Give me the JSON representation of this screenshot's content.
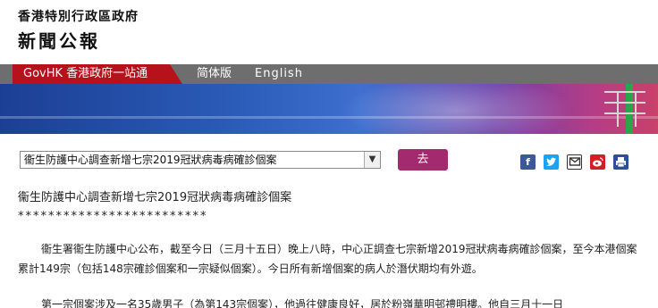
{
  "header": {
    "gov_name": "香港特別行政區政府",
    "press_title": "新聞公報"
  },
  "nav": {
    "govhk_label": "GovHK 香港政府一站通",
    "simplified_label": "简体版",
    "english_label": "English"
  },
  "controls": {
    "select_value": "衞生防護中心調查新增七宗2019冠狀病毒病確診個案",
    "go_label": "去"
  },
  "share_icons": {
    "facebook": "facebook-icon",
    "twitter": "twitter-icon",
    "email": "email-icon",
    "weibo": "weibo-icon",
    "print": "print-icon"
  },
  "article": {
    "headline": "衞生防護中心調查新增七宗2019冠狀病毒病確診個案",
    "stars": "*************************",
    "para1": "衞生署衞生防護中心公布，截至今日（三月十五日）晚上八時，中心正調查七宗新增2019冠狀病毒病確診個案，至今本港個案累計149宗（包括148宗確診個案和一宗疑似個案）。今日所有新增個案的病人於潛伏期均有外遊。",
    "para2": "第一宗個案涉及一名35歲男子（為第143宗個案），他過往健康良好，居於粉嶺華明邨禮明樓。他自三月十一日"
  },
  "colors": {
    "brand_red": "#b5121b",
    "nav_gray": "#6e6e6e",
    "go_button": "#a32a6e"
  }
}
